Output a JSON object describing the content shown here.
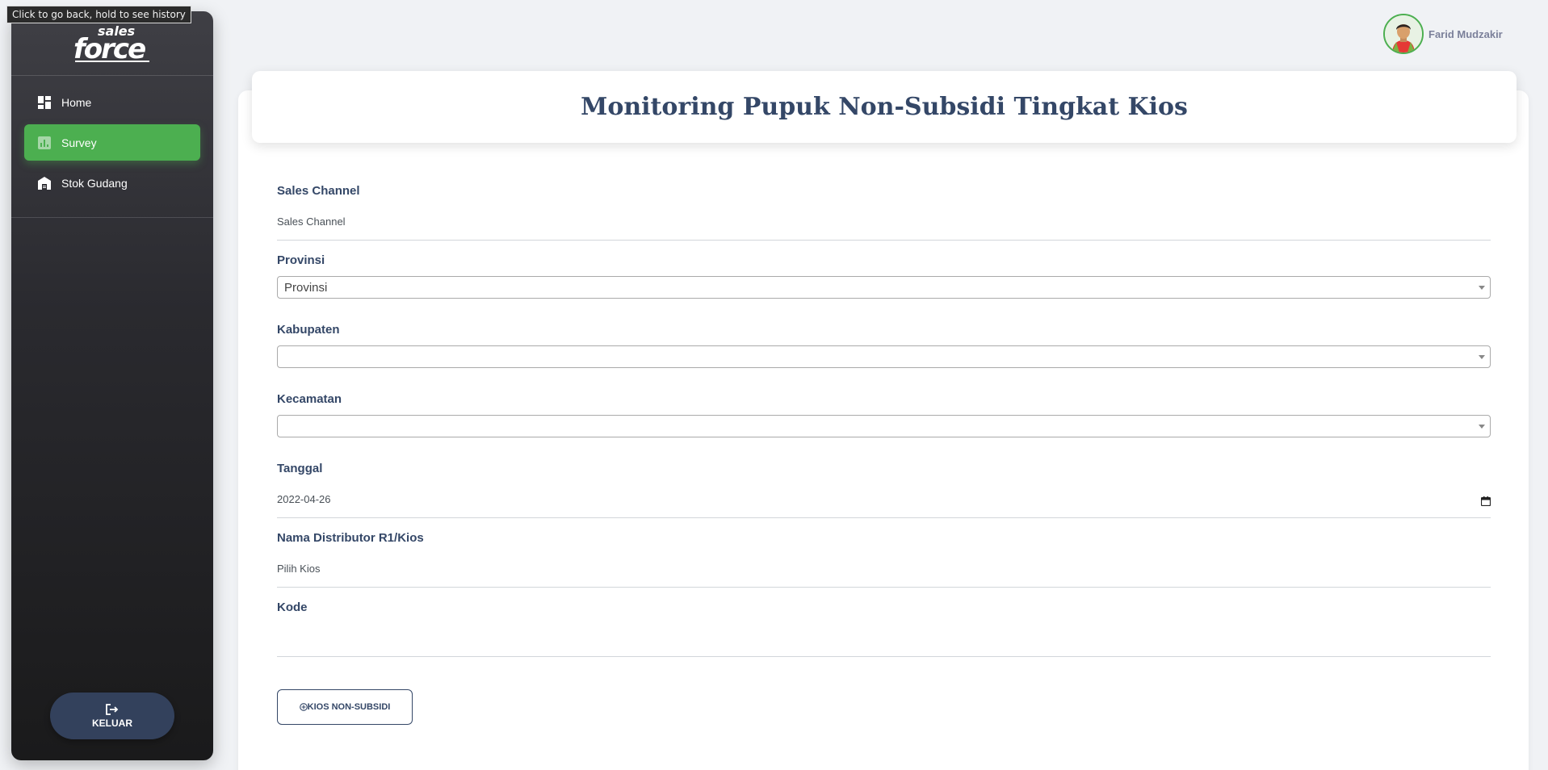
{
  "tooltip": "Click to go back, hold to see history",
  "sidebar": {
    "logo_text": "sales force",
    "items": [
      {
        "label": "Home",
        "icon": "dashboard-icon",
        "active": false
      },
      {
        "label": "Survey",
        "icon": "chart-icon",
        "active": true
      },
      {
        "label": "Stok Gudang",
        "icon": "warehouse-icon",
        "active": false
      }
    ],
    "logout_label": "KELUAR"
  },
  "user": {
    "name": "Farid Mudzakir"
  },
  "page": {
    "title": "Monitoring Pupuk Non-Subsidi Tingkat Kios"
  },
  "form": {
    "sales_channel": {
      "label": "Sales Channel",
      "placeholder": "Sales Channel"
    },
    "provinsi": {
      "label": "Provinsi",
      "value": "Provinsi"
    },
    "kabupaten": {
      "label": "Kabupaten",
      "value": ""
    },
    "kecamatan": {
      "label": "Kecamatan",
      "value": ""
    },
    "tanggal": {
      "label": "Tanggal",
      "value": "2022-04-26"
    },
    "distributor": {
      "label": "Nama Distributor R1/Kios",
      "placeholder": "Pilih Kios"
    },
    "kode": {
      "label": "Kode",
      "value": ""
    },
    "add_button": "KIOS NON-SUBSIDI"
  },
  "colors": {
    "accent": "#4caf50",
    "primary": "#344767",
    "logout_bg": "#33415c"
  }
}
